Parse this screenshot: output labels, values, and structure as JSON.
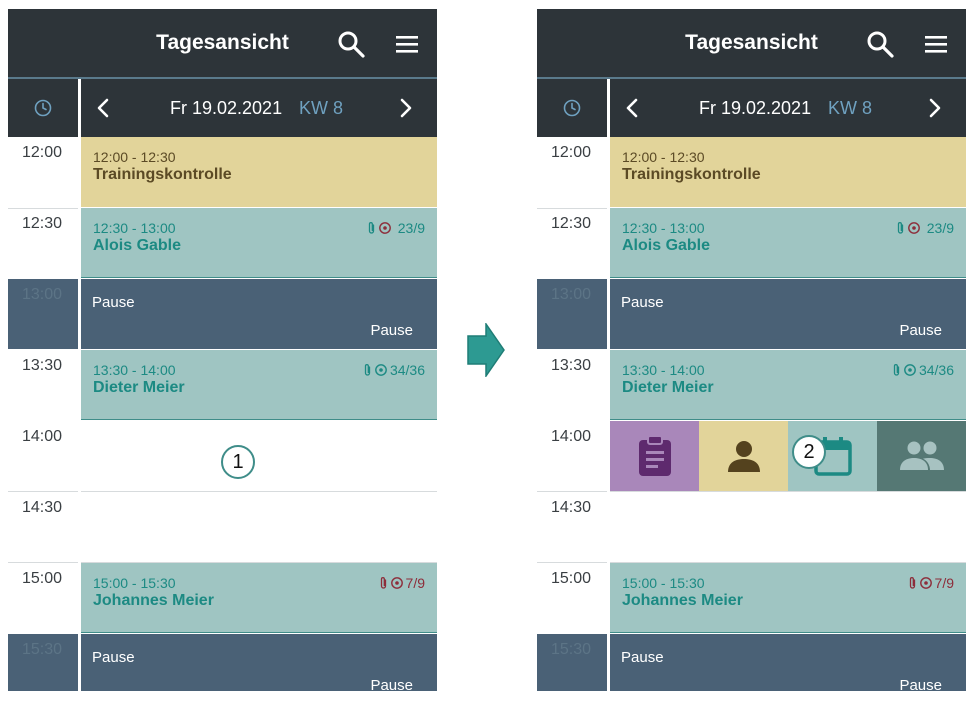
{
  "colors": {
    "appbar": "#2d3439",
    "accent_blue": "#6fa1c0",
    "yellow_event": "#e2d49a",
    "teal_event": "#9fc5c2",
    "teal_text": "#1c8a83",
    "pause": "#4a6176",
    "action_purple": "#a987ba",
    "action_yellow": "#e2d49a",
    "action_teal": "#9fc5c2",
    "action_dark": "#557874",
    "arrow": "#2d9a92"
  },
  "left": {
    "title": "Tagesansicht",
    "date": "Fr 19.02.2021",
    "week": "KW 8",
    "times": [
      "12:00",
      "12:30",
      "13:00",
      "13:30",
      "14:00",
      "14:30",
      "15:00",
      "15:30"
    ],
    "events": [
      {
        "time": "12:00 - 12:30",
        "name": "Trainingskontrolle"
      },
      {
        "time": "12:30 - 13:00",
        "name": "Alois Gable",
        "meta": "23/9"
      },
      {
        "label": "Pause",
        "sub": "Pause"
      },
      {
        "time": "13:30 - 14:00",
        "name": "Dieter Meier",
        "meta": "34/36"
      },
      {
        "time": "15:00 - 15:30",
        "name": "Johannes Meier",
        "meta": "7/9"
      },
      {
        "label": "Pause",
        "sub": "Pause"
      }
    ],
    "badge": "1"
  },
  "right": {
    "title": "Tagesansicht",
    "date": "Fr 19.02.2021",
    "week": "KW 8",
    "times": [
      "12:00",
      "12:30",
      "13:00",
      "13:30",
      "14:00",
      "14:30",
      "15:00",
      "15:30"
    ],
    "events": [
      {
        "time": "12:00 - 12:30",
        "name": "Trainingskontrolle"
      },
      {
        "time": "12:30 - 13:00",
        "name": "Alois Gable",
        "meta": "23/9"
      },
      {
        "label": "Pause",
        "sub": "Pause"
      },
      {
        "time": "13:30 - 14:00",
        "name": "Dieter Meier",
        "meta": "34/36"
      },
      {
        "time": "15:00 - 15:30",
        "name": "Johannes Meier",
        "meta": "7/9"
      },
      {
        "label": "Pause",
        "sub": "Pause"
      }
    ],
    "actions": [
      "clipboard-icon",
      "person-icon",
      "calendar-icon",
      "group-icon"
    ],
    "badge": "2"
  }
}
